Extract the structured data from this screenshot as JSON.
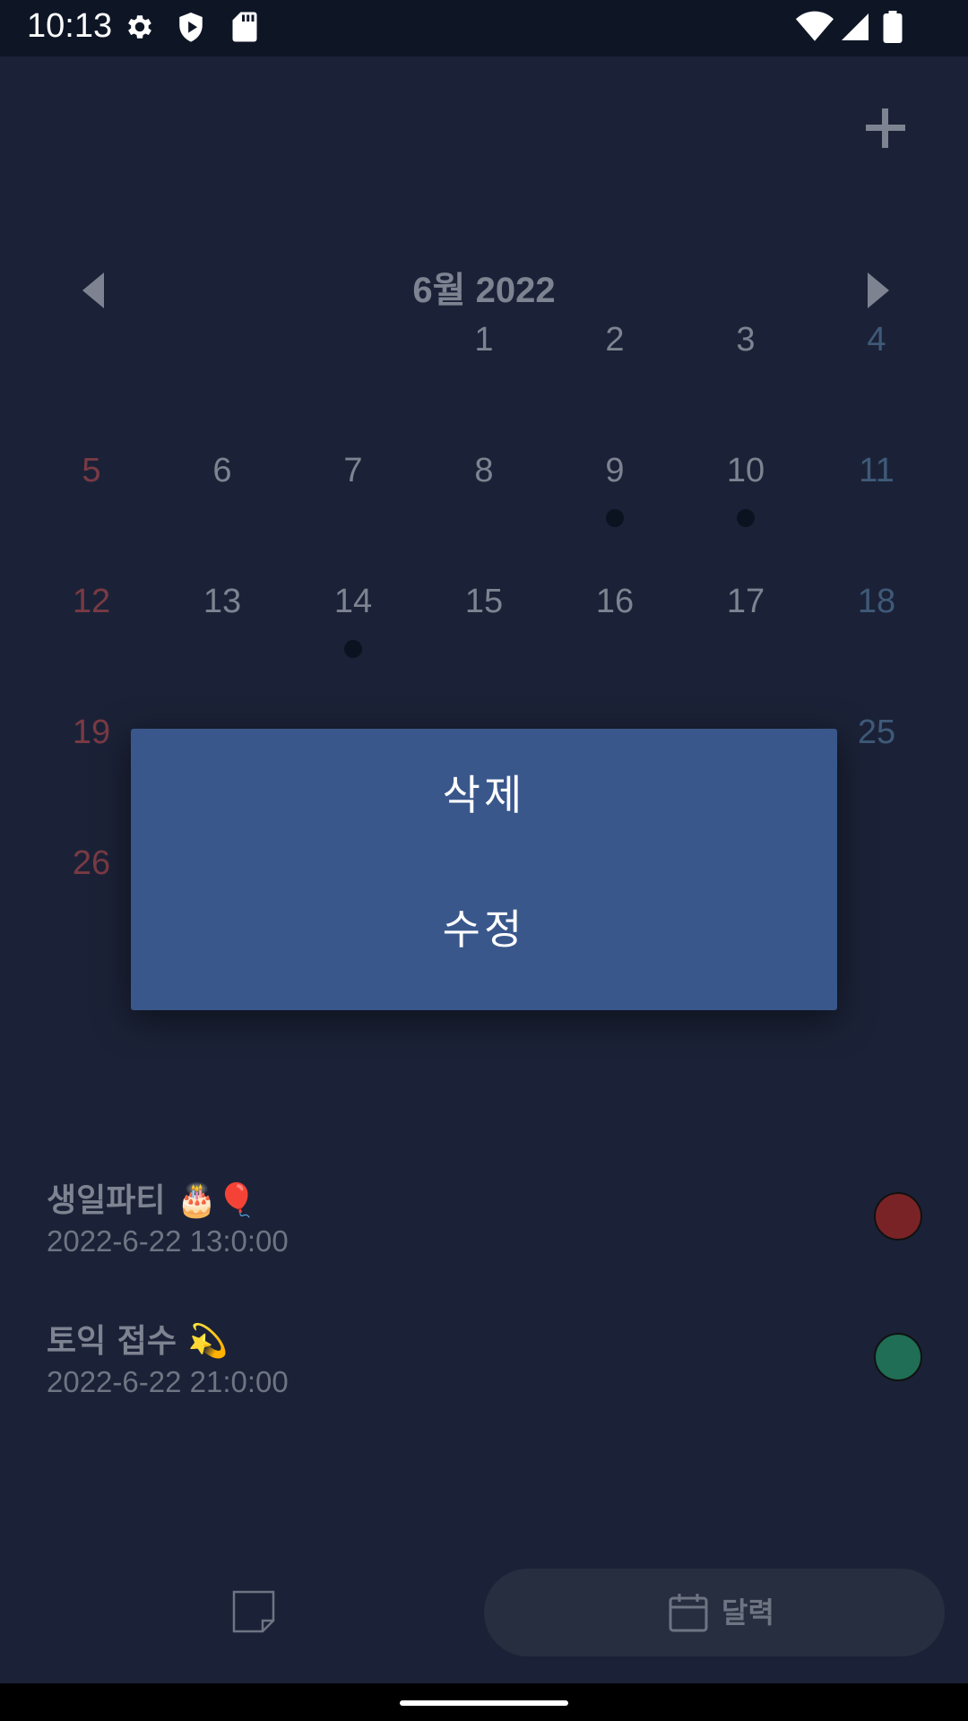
{
  "status_bar": {
    "time": "10:13",
    "icons_left": [
      "gear-icon",
      "shield-play-icon",
      "sd-card-icon"
    ],
    "icons_right": [
      "wifi-icon",
      "signal-icon",
      "battery-icon"
    ]
  },
  "header": {
    "add_icon": "plus-icon"
  },
  "calendar": {
    "month_title": "6월 2022",
    "prev_icon": "triangle-left-icon",
    "next_icon": "triangle-right-icon",
    "weeks": [
      [
        "",
        "",
        "",
        "1",
        "2",
        "3",
        "4"
      ],
      [
        "5",
        "6",
        "7",
        "8",
        "9",
        "10",
        "11"
      ],
      [
        "12",
        "13",
        "14",
        "15",
        "16",
        "17",
        "18"
      ],
      [
        "19",
        "",
        "",
        "",
        "",
        "",
        "25"
      ],
      [
        "26",
        "",
        "",
        "",
        "",
        "",
        ""
      ]
    ],
    "days_with_events": [
      "9",
      "10",
      "14"
    ]
  },
  "events": [
    {
      "title": "생일파티 🎂🎈",
      "time": "2022-6-22 13:0:00",
      "color": "#7a2326"
    },
    {
      "title": "토익 접수 💫",
      "time": "2022-6-22 21:0:00",
      "color": "#1f6e55"
    }
  ],
  "bottom_nav": {
    "memo_icon": "note-icon",
    "calendar_icon": "calendar-icon",
    "calendar_label": "달력"
  },
  "dialog": {
    "delete_label": "삭제",
    "edit_label": "수정"
  },
  "colors": {
    "background": "#1b2237",
    "dialog": "#39578b",
    "sunday": "#7a3a44",
    "saturday": "#3f5a78"
  }
}
